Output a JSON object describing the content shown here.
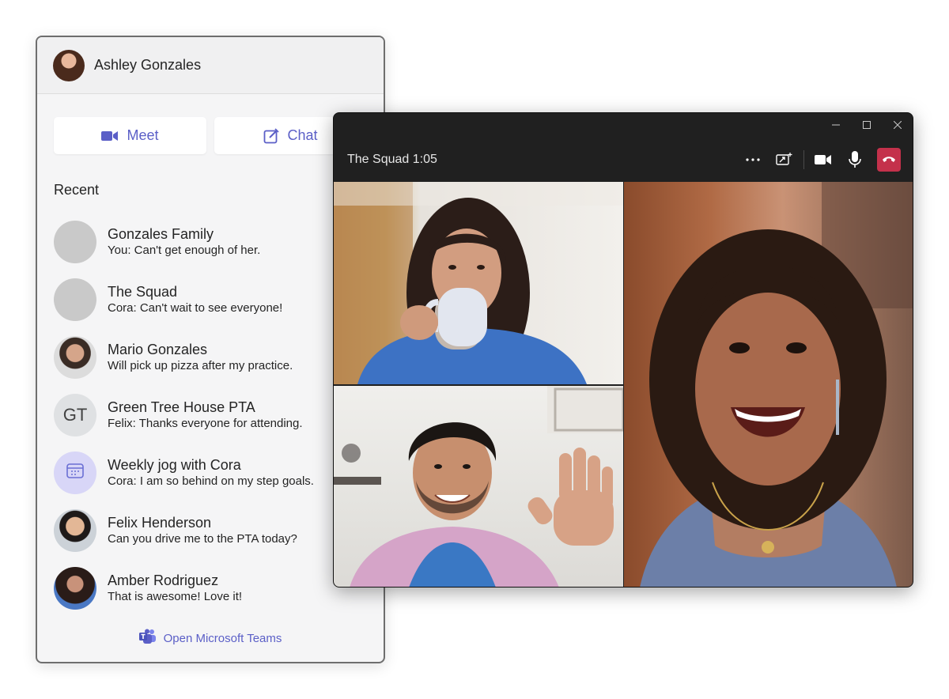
{
  "user": {
    "name": "Ashley Gonzales"
  },
  "actions": {
    "meet_label": "Meet",
    "chat_label": "Chat"
  },
  "recent": {
    "title": "Recent",
    "items": [
      {
        "name": "Gonzales Family",
        "preview": "You: Can't get enough of her."
      },
      {
        "name": "The Squad",
        "preview": "Cora: Can't wait to see everyone!"
      },
      {
        "name": "Mario Gonzales",
        "preview": "Will pick up pizza after my practice."
      },
      {
        "name": "Green Tree House PTA",
        "preview": "Felix: Thanks everyone for attending.",
        "initials": "GT"
      },
      {
        "name": "Weekly jog with Cora",
        "preview": "Cora: I am so behind on my step goals."
      },
      {
        "name": "Felix Henderson",
        "preview": "Can you drive me to the PTA today?"
      },
      {
        "name": "Amber Rodriguez",
        "preview": "That is awesome! Love it!"
      }
    ]
  },
  "footer": {
    "open_teams_label": "Open Microsoft Teams"
  },
  "call": {
    "title": "The Squad 1:05"
  },
  "colors": {
    "accent": "#5b5fc7",
    "hangup": "#c4314b",
    "call_bg": "#202020"
  },
  "icons": [
    "video-camera-icon",
    "compose-icon",
    "calendar-icon",
    "teams-logo-icon",
    "more-options-icon",
    "share-screen-icon",
    "camera-icon",
    "microphone-icon",
    "hang-up-icon",
    "minimize-icon",
    "maximize-icon",
    "close-icon"
  ]
}
